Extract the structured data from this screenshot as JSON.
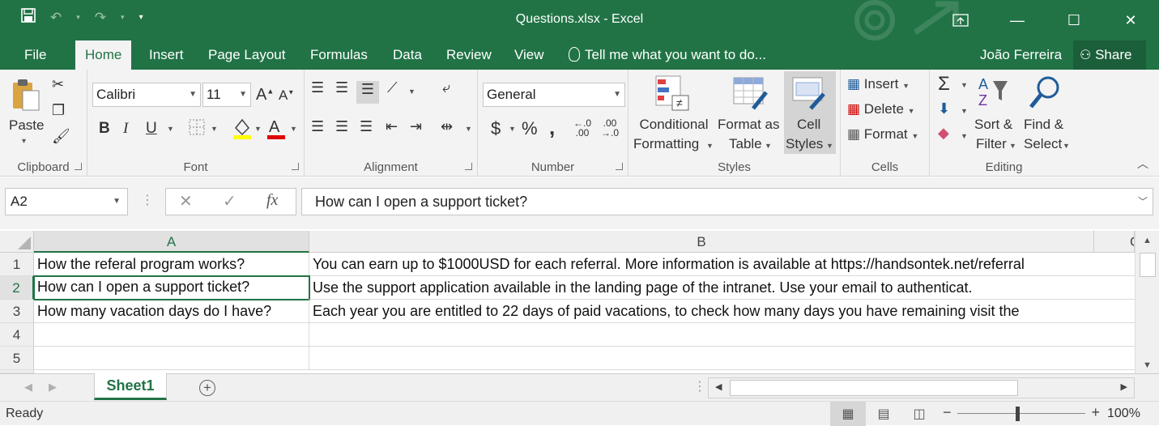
{
  "window": {
    "title": "Questions.xlsx - Excel",
    "qat": {
      "save_icon": "save-icon",
      "undo_icon": "undo-icon",
      "redo_icon": "redo-icon"
    }
  },
  "tabs": [
    {
      "label": "File"
    },
    {
      "label": "Home"
    },
    {
      "label": "Insert"
    },
    {
      "label": "Page Layout"
    },
    {
      "label": "Formulas"
    },
    {
      "label": "Data"
    },
    {
      "label": "Review"
    },
    {
      "label": "View"
    }
  ],
  "active_tab": "Home",
  "tell_me": "Tell me what you want to do...",
  "user": "João Ferreira",
  "share_label": "Share",
  "ribbon": {
    "clipboard": {
      "label": "Clipboard",
      "paste": "Paste"
    },
    "font": {
      "label": "Font",
      "name": "Calibri",
      "size": "11",
      "bold": "B",
      "italic": "I",
      "underline": "U"
    },
    "alignment": {
      "label": "Alignment"
    },
    "number": {
      "label": "Number",
      "format": "General",
      "currency": "$",
      "percent": "%",
      "comma": ","
    },
    "styles": {
      "label": "Styles",
      "conditional_line1": "Conditional",
      "conditional_line2": "Formatting",
      "format_table_line1": "Format as",
      "format_table_line2": "Table",
      "cell_styles_line1": "Cell",
      "cell_styles_line2": "Styles"
    },
    "cells": {
      "label": "Cells",
      "insert": "Insert",
      "delete": "Delete",
      "format": "Format"
    },
    "editing": {
      "label": "Editing",
      "sort_line1": "Sort &",
      "sort_line2": "Filter",
      "find_line1": "Find &",
      "find_line2": "Select"
    }
  },
  "formula_bar": {
    "name_box": "A2",
    "fx": "fx",
    "content": "How can I open a support ticket?"
  },
  "sheet": {
    "columns": [
      "A",
      "B",
      "C"
    ],
    "selected_column": "A",
    "selected_row": "2",
    "rows": [
      {
        "num": "1",
        "a": "How the referal program works?",
        "b": "You can earn up to $1000USD for each referral. More information is available at https://handsontek.net/referral"
      },
      {
        "num": "2",
        "a": "How can I open a support ticket?",
        "b": "Use the support application available in the landing page of the intranet. Use your email to authenticat."
      },
      {
        "num": "3",
        "a": "How many vacation days do I have?",
        "b": "Each year you are entitled to 22 days of paid vacations, to check how many days you have remaining visit the"
      },
      {
        "num": "4",
        "a": "",
        "b": ""
      },
      {
        "num": "5",
        "a": "",
        "b": ""
      }
    ]
  },
  "sheet_tabs": [
    {
      "label": "Sheet1"
    }
  ],
  "status": {
    "text": "Ready",
    "zoom": "100%"
  },
  "colors": {
    "brand": "#217346",
    "ribbon_bg": "#f3f3f3"
  }
}
